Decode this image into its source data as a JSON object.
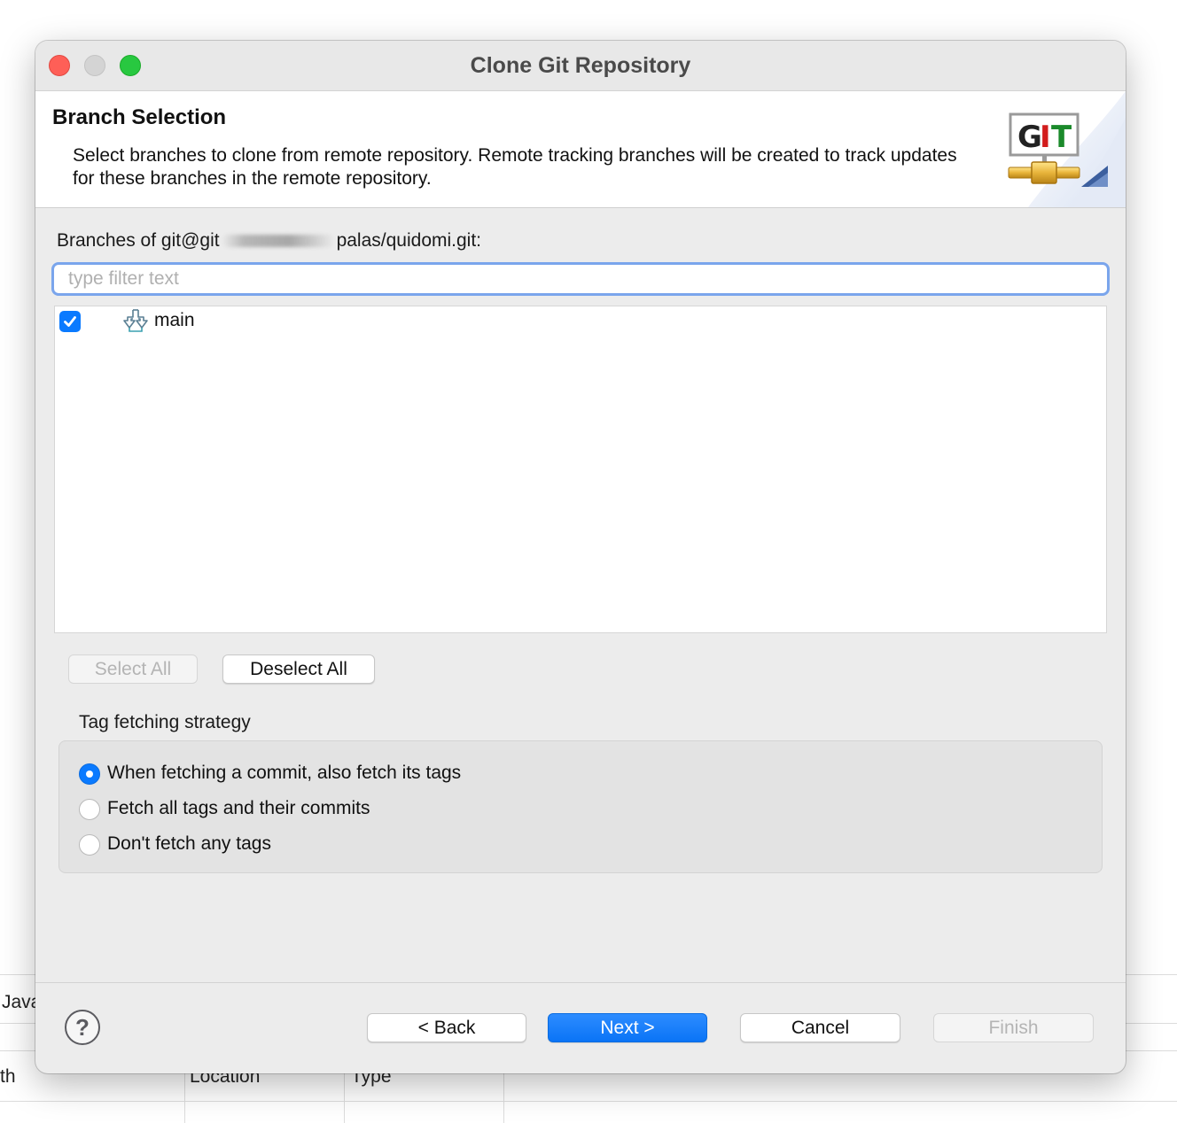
{
  "dialog": {
    "title": "Clone Git Repository",
    "header": {
      "title": "Branch Selection",
      "description": "Select branches to clone from remote repository. Remote tracking branches will be created to track updates for these branches in the remote repository.",
      "logo_text": "GIT"
    },
    "branches_label_prefix": "Branches of git@git",
    "branches_label_suffix": "palas/quidomi.git:",
    "filter": {
      "placeholder": "type filter text",
      "value": ""
    },
    "branches": [
      {
        "name": "main",
        "checked": true,
        "icon": "branch-icon"
      }
    ],
    "select_all_label": "Select All",
    "deselect_all_label": "Deselect All",
    "tag_strategy": {
      "label": "Tag fetching strategy",
      "options": [
        {
          "label": "When fetching a commit, also fetch its tags",
          "selected": true
        },
        {
          "label": "Fetch all tags and their commits",
          "selected": false
        },
        {
          "label": "Don't fetch any tags",
          "selected": false
        }
      ]
    },
    "buttons": {
      "help": "?",
      "back": "< Back",
      "next": "Next >",
      "cancel": "Cancel",
      "finish": "Finish"
    }
  },
  "background": {
    "row1_text": "Java",
    "col1": "th",
    "col2": "Location",
    "col3": "Type"
  },
  "colors": {
    "accent": "#0a7aff",
    "focus_ring": "#7aa5ec",
    "close": "#fe5f57",
    "maximize": "#28c840"
  }
}
